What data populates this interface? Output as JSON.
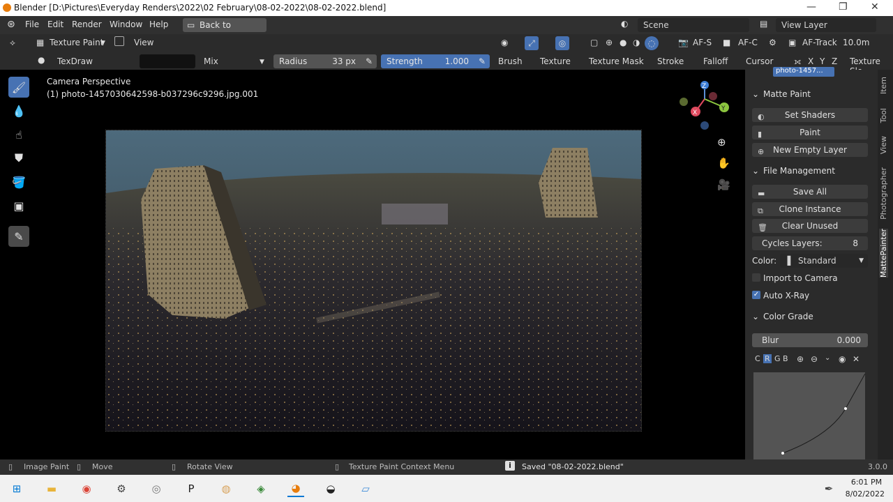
{
  "window": {
    "title": "Blender [D:\\Pictures\\Everyday Renders\\2022\\02 February\\08-02-2022\\08-02-2022.blend]",
    "minimize": "—",
    "maximize": "❐",
    "close": "✕"
  },
  "menubar": {
    "items": [
      "File",
      "Edit",
      "Render",
      "Window",
      "Help"
    ],
    "back_button": "Back to Previous",
    "scene": "Scene",
    "view_layer": "View Layer"
  },
  "header": {
    "mode": "Texture Paint",
    "view_menu": "View",
    "af_s": "AF-S",
    "af_c": "AF-C",
    "af_track": "AF-Track",
    "distance": "10.0m"
  },
  "tool_settings": {
    "brush_name": "TexDraw",
    "blend_mode": "Mix",
    "radius_label": "Radius",
    "radius_value": "33 px",
    "strength_label": "Strength",
    "strength_value": "1.000",
    "menus": [
      "Brush",
      "Texture",
      "Texture Mask",
      "Stroke",
      "Falloff",
      "Cursor"
    ],
    "axes": [
      "X",
      "Y",
      "Z"
    ],
    "texture_slots": "Texture Slo",
    "brush_color": "#111111",
    "radius_fill": "#545454",
    "strength_fill": "#4772b3"
  },
  "viewport": {
    "perspective": "Camera Perspective",
    "object_name": "(1) photo-1457030642598-b037296c9296.jpg.001",
    "gizmo": {
      "x": "X",
      "y": "Y",
      "z": "Z"
    }
  },
  "npanel": {
    "top_item": "photo-1457...",
    "section_matte": "Matte Paint",
    "set_shaders": "Set Shaders",
    "paint": "Paint",
    "new_empty_layer": "New Empty Layer",
    "section_file": "File Management",
    "save_all": "Save All",
    "clone_instance": "Clone Instance",
    "clear_unused": "Clear Unused",
    "cycles_layers_label": "Cycles Layers:",
    "cycles_layers_value": "8",
    "color_label": "Color:",
    "color_value": "Standard",
    "import_to_camera": "Import to Camera",
    "import_to_camera_checked": false,
    "auto_xray": "Auto X-Ray",
    "auto_xray_checked": true,
    "section_grade": "Color Grade",
    "blur_label": "Blur",
    "blur_value": "0.000",
    "channels": [
      "C",
      "R",
      "G",
      "B"
    ],
    "tabs": [
      "Item",
      "Tool",
      "View",
      "Photographer",
      "MattePainter"
    ]
  },
  "statusbar": {
    "image_paint": "Image Paint",
    "move": "Move",
    "rotate_view": "Rotate View",
    "context_menu": "Texture Paint Context Menu",
    "saved": "Saved \"08-02-2022.blend\"",
    "version": "3.0.0"
  },
  "taskbar": {
    "time": "6:01 PM",
    "date": "8/02/2022"
  }
}
